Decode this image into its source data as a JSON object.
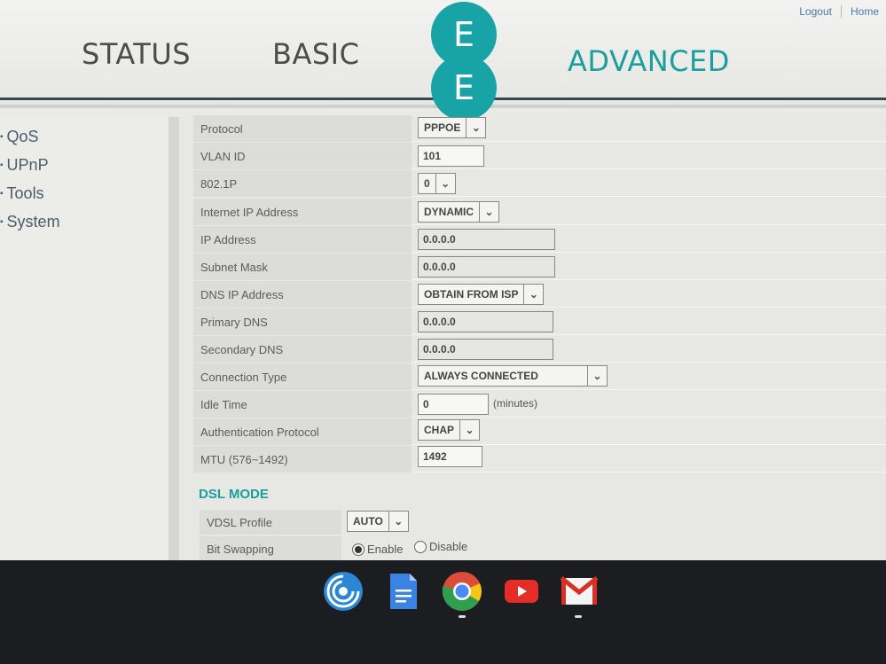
{
  "header": {
    "links": {
      "logout": "Logout",
      "home": "Home"
    },
    "nav": {
      "status": "STATUS",
      "basic": "BASIC",
      "advanced": "ADVANCED"
    },
    "logo": {
      "top": "E",
      "bottom": "E"
    },
    "colors": {
      "accent": "#1a9e9e",
      "logo": "#18a3a7"
    }
  },
  "sidebar": {
    "items": [
      {
        "label": "QoS"
      },
      {
        "label": "UPnP"
      },
      {
        "label": "Tools"
      },
      {
        "label": "System"
      }
    ]
  },
  "form": {
    "protocol": {
      "label": "Protocol",
      "value": "PPPOE"
    },
    "vlan_id": {
      "label": "VLAN ID",
      "value": "101"
    },
    "dot1p": {
      "label": "802.1P",
      "value": "0"
    },
    "internet_ip": {
      "label": "Internet IP Address",
      "value": "DYNAMIC"
    },
    "ip_address": {
      "label": "IP Address",
      "value": "0.0.0.0"
    },
    "subnet_mask": {
      "label": "Subnet Mask",
      "value": "0.0.0.0"
    },
    "dns_ip": {
      "label": "DNS IP Address",
      "value": "OBTAIN FROM ISP"
    },
    "primary_dns": {
      "label": "Primary DNS",
      "value": "0.0.0.0"
    },
    "secondary_dns": {
      "label": "Secondary DNS",
      "value": "0.0.0.0"
    },
    "connection_type": {
      "label": "Connection Type",
      "value": "ALWAYS CONNECTED"
    },
    "idle_time": {
      "label": "Idle Time",
      "value": "0",
      "suffix": "(minutes)"
    },
    "auth_protocol": {
      "label": "Authentication Protocol",
      "value": "CHAP"
    },
    "mtu": {
      "label": "MTU (576~1492)",
      "value": "1492"
    }
  },
  "dsl": {
    "title": "DSL MODE",
    "vdsl_profile": {
      "label": "VDSL Profile",
      "value": "AUTO"
    },
    "bit_swapping": {
      "label": "Bit Swapping",
      "enable": "Enable",
      "disable": "Disable",
      "selected": "Enable"
    }
  },
  "taskbar": {
    "apps": [
      "cast-app-icon",
      "docs-icon",
      "chrome-icon",
      "youtube-icon",
      "gmail-icon"
    ]
  }
}
